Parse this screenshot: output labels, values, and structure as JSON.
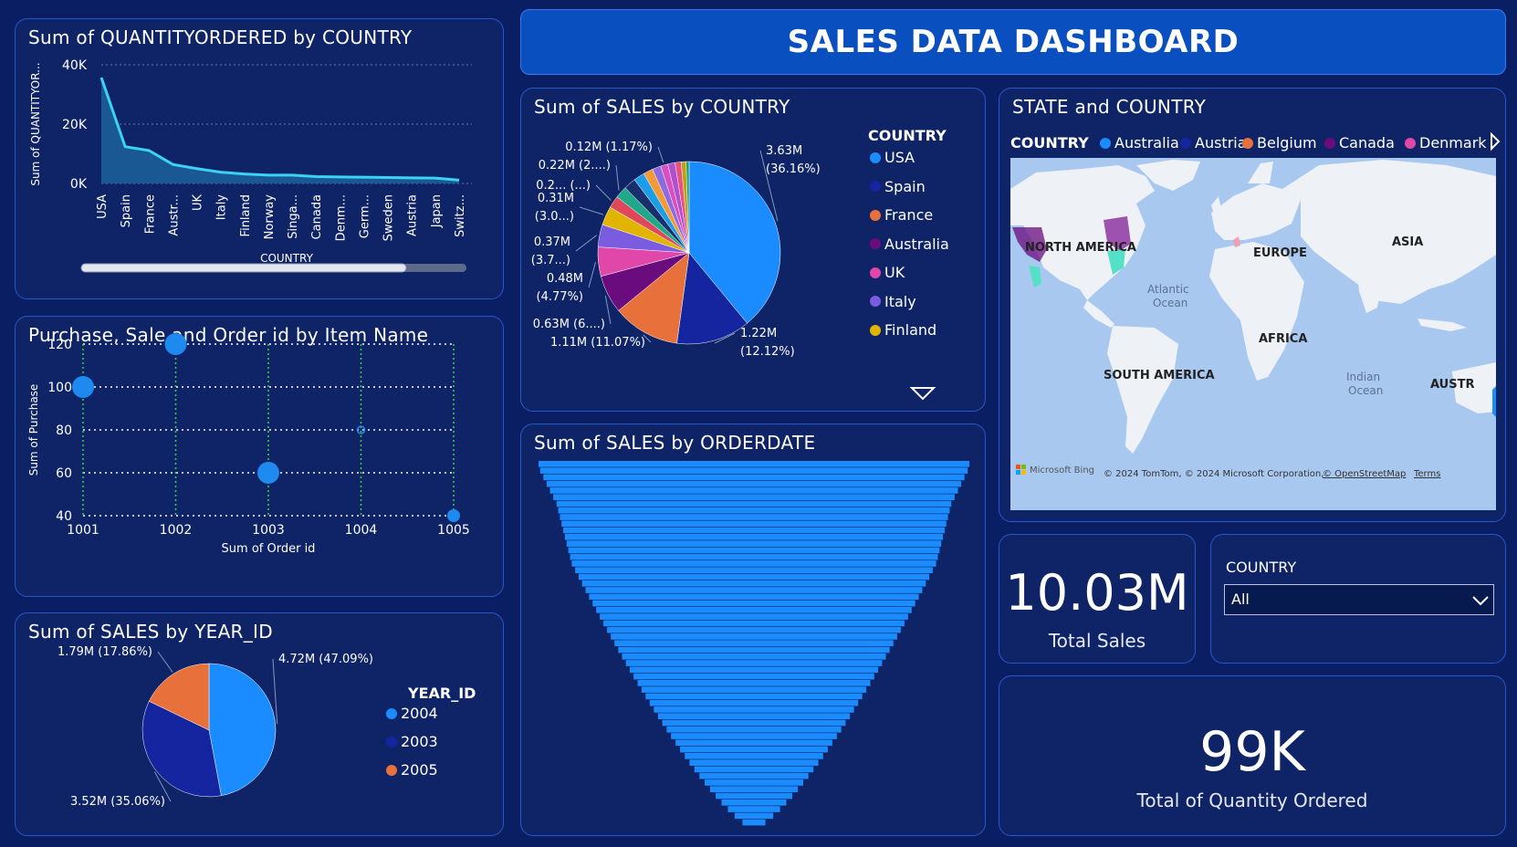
{
  "dashboard": {
    "title": "SALES DATA DASHBOARD"
  },
  "qty_chart": {
    "title": "Sum of QUANTITYORDERED by COUNTRY",
    "chart_data": {
      "type": "area",
      "categories": [
        "USA",
        "Spain",
        "France",
        "Austr...",
        "UK",
        "Italy",
        "Finland",
        "Norway",
        "Singa...",
        "Canada",
        "Denm...",
        "Germ...",
        "Sweden",
        "Austria",
        "Japan",
        "Switz..."
      ],
      "values": [
        35700,
        12400,
        11100,
        6400,
        5000,
        3800,
        3200,
        2800,
        2800,
        2300,
        2200,
        2100,
        2000,
        1900,
        1800,
        1100
      ],
      "xlabel": "COUNTRY",
      "ylabel": "Sum of QUANTITYOR...",
      "ylim": [
        0,
        40000
      ],
      "yticks": [
        "0K",
        "20K",
        "40K"
      ],
      "color": "#3ad3f5"
    }
  },
  "scatter_chart": {
    "title": "Purchase, Sale and Order id by Item Name",
    "chart_data": {
      "type": "scatter",
      "x": [
        1001,
        1002,
        1003,
        1004,
        1005
      ],
      "y": [
        100,
        120,
        60,
        80,
        40
      ],
      "size": [
        3,
        3,
        3,
        1,
        2
      ],
      "xlabel": "Sum of Order id",
      "ylabel": "Sum of Purchase",
      "xlim": [
        1001,
        1005
      ],
      "ylim": [
        40,
        120
      ],
      "xticks": [
        "1001",
        "1002",
        "1003",
        "1004",
        "1005"
      ],
      "yticks": [
        "40",
        "60",
        "80",
        "100",
        "120"
      ],
      "color": "#1e8af0"
    }
  },
  "year_chart": {
    "title": "Sum of SALES by YEAR_ID",
    "legend_title": "YEAR_ID",
    "chart_data": {
      "type": "pie",
      "categories": [
        "2004",
        "2003",
        "2005"
      ],
      "values": [
        4.72,
        3.52,
        1.79
      ],
      "labels": [
        "4.72M (47.09%)",
        "3.52M (35.06%)",
        "1.79M (17.86%)"
      ],
      "colors": [
        "#1a8cff",
        "#1525a0",
        "#e8703a"
      ]
    }
  },
  "country_pie": {
    "title": "Sum of SALES by COUNTRY",
    "legend_title": "COUNTRY",
    "legend": [
      {
        "name": "USA",
        "color": "#1a8cff"
      },
      {
        "name": "Spain",
        "color": "#1525a0"
      },
      {
        "name": "France",
        "color": "#e8703a"
      },
      {
        "name": "Australia",
        "color": "#6a0b7e"
      },
      {
        "name": "UK",
        "color": "#e047a8"
      },
      {
        "name": "Italy",
        "color": "#7b5ce0"
      },
      {
        "name": "Finland",
        "color": "#e0b400"
      }
    ],
    "chart_data": {
      "type": "pie",
      "values": [
        3.63,
        1.22,
        1.11,
        0.63,
        0.48,
        0.37,
        0.31,
        0.2,
        0.2,
        0.2,
        0.18,
        0.16,
        0.14,
        0.12,
        0.12,
        0.1,
        0.08,
        0.05
      ],
      "colors": [
        "#1a8cff",
        "#1525a0",
        "#e8703a",
        "#6a0b7e",
        "#e047a8",
        "#7b5ce0",
        "#e0b400",
        "#e0475a",
        "#1fa88a",
        "#18306e",
        "#1c9de8",
        "#f29a3a",
        "#8a6be0",
        "#d84fc0",
        "#b04fd0",
        "#e85080",
        "#c0a010",
        "#20a070"
      ],
      "labels": [
        "3.63M (36.16%)",
        "1.22M (12.12%)",
        "1.11M (11.07%)",
        "0.63M (6....)",
        "0.48M (4.77%)",
        "0.37M (3.7...)",
        "0.31M (3.0...)",
        "0.2... (...)",
        "0.22M (2....)",
        "0.12M (1.17%)"
      ]
    }
  },
  "orderdate_chart": {
    "title": "Sum of SALES by ORDERDATE",
    "chart_data": {
      "type": "bar",
      "orientation": "horizontal-centered",
      "values": [
        1.0,
        0.99,
        0.97,
        0.95,
        0.93,
        0.91,
        0.89,
        0.88,
        0.87,
        0.86,
        0.85,
        0.84,
        0.83,
        0.82,
        0.81,
        0.8,
        0.78,
        0.76,
        0.74,
        0.72,
        0.7,
        0.68,
        0.66,
        0.64,
        0.62,
        0.6,
        0.58,
        0.56,
        0.54,
        0.52,
        0.5,
        0.48,
        0.46,
        0.44,
        0.42,
        0.4,
        0.38,
        0.36,
        0.34,
        0.32,
        0.3,
        0.28,
        0.26,
        0.24,
        0.22,
        0.2,
        0.18,
        0.16,
        0.14,
        0.12,
        0.1,
        0.08,
        0.06,
        0.04,
        0.02
      ],
      "color": "#1a8cff"
    }
  },
  "map": {
    "title": "STATE and COUNTRY",
    "legend_title": "COUNTRY",
    "legend": [
      {
        "name": "Australia",
        "color": "#1a8cff"
      },
      {
        "name": "Austria",
        "color": "#1525a0"
      },
      {
        "name": "Belgium",
        "color": "#e8703a"
      },
      {
        "name": "Canada",
        "color": "#6a0b7e"
      },
      {
        "name": "Denmark",
        "color": "#e047a8"
      }
    ],
    "labels": {
      "north_america": "NORTH AMERICA",
      "europe": "EUROPE",
      "asia": "ASIA",
      "africa": "AFRICA",
      "south_america": "SOUTH AMERICA",
      "atlantic": "Atlantic",
      "atlantic2": "Ocean",
      "indian": "Indian",
      "indian2": "Ocean",
      "austr": "AUSTR"
    },
    "bing": "Microsoft Bing",
    "copyright": "© 2024 TomTom, © 2024 Microsoft Corporation,",
    "osm": "© OpenStreetMap",
    "terms": "Terms"
  },
  "kpi_sales": {
    "value": "10.03M",
    "label": "Total Sales"
  },
  "kpi_qty": {
    "value": "99K",
    "label": "Total of Quantity Ordered"
  },
  "slicer": {
    "title": "COUNTRY",
    "selected": "All"
  }
}
